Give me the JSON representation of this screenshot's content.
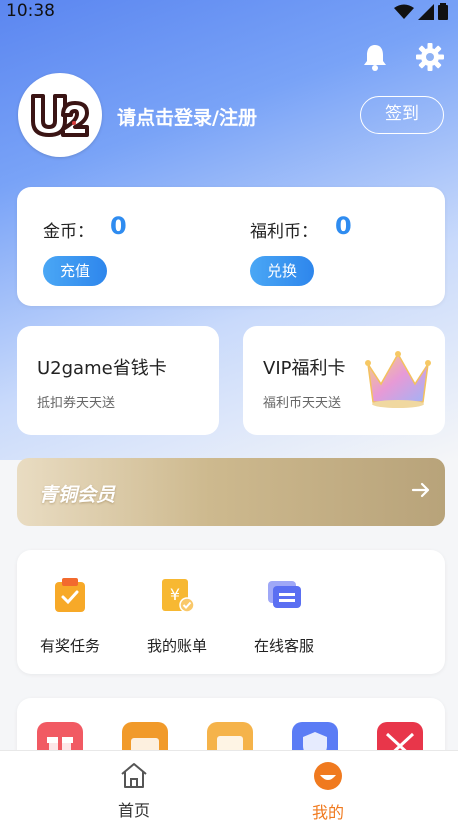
{
  "status": {
    "time": "10:38"
  },
  "profile": {
    "login_text": "请点击登录/注册",
    "signin_label": "签到"
  },
  "wallet": {
    "gold_label": "金币：",
    "gold_value": "0",
    "recharge_label": "充值",
    "welfare_label": "福利币：",
    "welfare_value": "0",
    "exchange_label": "兑换"
  },
  "promos": [
    {
      "title": "U2game省钱卡",
      "subtitle": "抵扣券天天送"
    },
    {
      "title": "VIP福利卡",
      "subtitle": "福利币天天送"
    }
  ],
  "membership": {
    "label": "青铜会员"
  },
  "services": [
    {
      "label": "有奖任务",
      "icon": "task-clipboard-icon"
    },
    {
      "label": "我的账单",
      "icon": "bill-icon"
    },
    {
      "label": "在线客服",
      "icon": "chat-icon"
    }
  ],
  "tools": [
    {
      "icon": "gift-icon",
      "color": "#f15a63"
    },
    {
      "icon": "ticket-icon",
      "color": "#f19a2a"
    },
    {
      "icon": "coupon-icon",
      "color": "#f5b34a"
    },
    {
      "icon": "shield-icon",
      "color": "#5b7cf5"
    },
    {
      "icon": "game-icon",
      "color": "#e8364a"
    }
  ],
  "tabbar": {
    "home_label": "首页",
    "mine_label": "我的"
  },
  "colors": {
    "accent": "#2f8cf0",
    "tab_active": "#f07a1f"
  }
}
